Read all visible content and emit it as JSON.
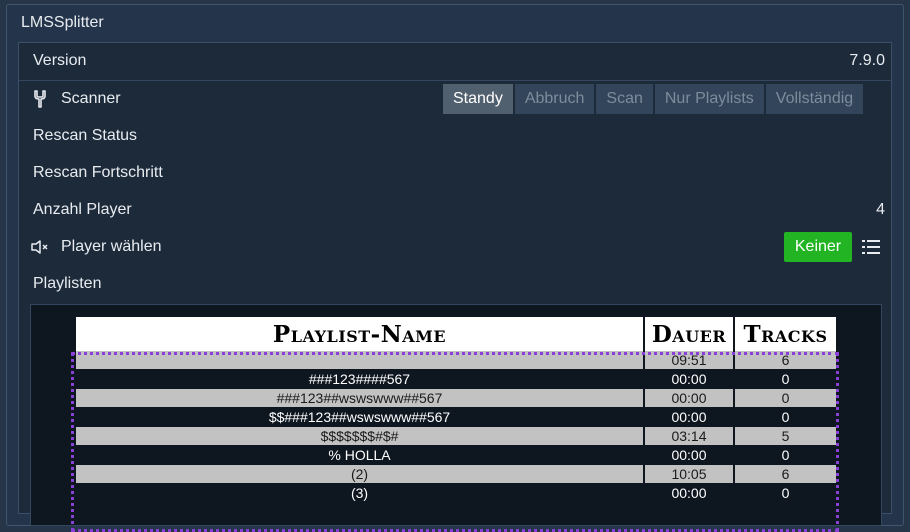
{
  "app": {
    "title": "LMSSplitter"
  },
  "rows": {
    "version": {
      "label": "Version",
      "value": "7.9.0"
    },
    "scanner": {
      "label": "Scanner",
      "buttons": [
        "Standy",
        "Abbruch",
        "Scan",
        "Nur Playlists",
        "Vollständig"
      ],
      "active": "Standy"
    },
    "rescan_status": {
      "label": "Rescan Status"
    },
    "rescan_progress": {
      "label": "Rescan Fortschritt"
    },
    "player_count": {
      "label": "Anzahl Player",
      "value": "4"
    },
    "player_select": {
      "label": "Player wählen",
      "button": "Keiner"
    },
    "playlists": {
      "label": "Playlisten"
    }
  },
  "colors": {
    "accent_green": "#22b422",
    "selection_dotted": "#8a3fd6"
  },
  "icons": {
    "scanner": "wrench-icon",
    "player": "speaker-muted-icon",
    "menu": "list-icon"
  },
  "playlist_table": {
    "headers": [
      "Playlist-Name",
      "Dauer",
      "Tracks"
    ],
    "rows": [
      {
        "name": "",
        "duration": "09:51",
        "tracks": "6"
      },
      {
        "name": "###123####567",
        "duration": "00:00",
        "tracks": "0"
      },
      {
        "name": "###123##wswswww##567",
        "duration": "00:00",
        "tracks": "0"
      },
      {
        "name": "$$###123##wswswww##567",
        "duration": "00:00",
        "tracks": "0"
      },
      {
        "name": "$$$$$$$#$#",
        "duration": "03:14",
        "tracks": "5"
      },
      {
        "name": "% HOLLA",
        "duration": "00:00",
        "tracks": "0"
      },
      {
        "name": "(2)",
        "duration": "10:05",
        "tracks": "6"
      },
      {
        "name": "(3)",
        "duration": "00:00",
        "tracks": "0"
      }
    ]
  }
}
